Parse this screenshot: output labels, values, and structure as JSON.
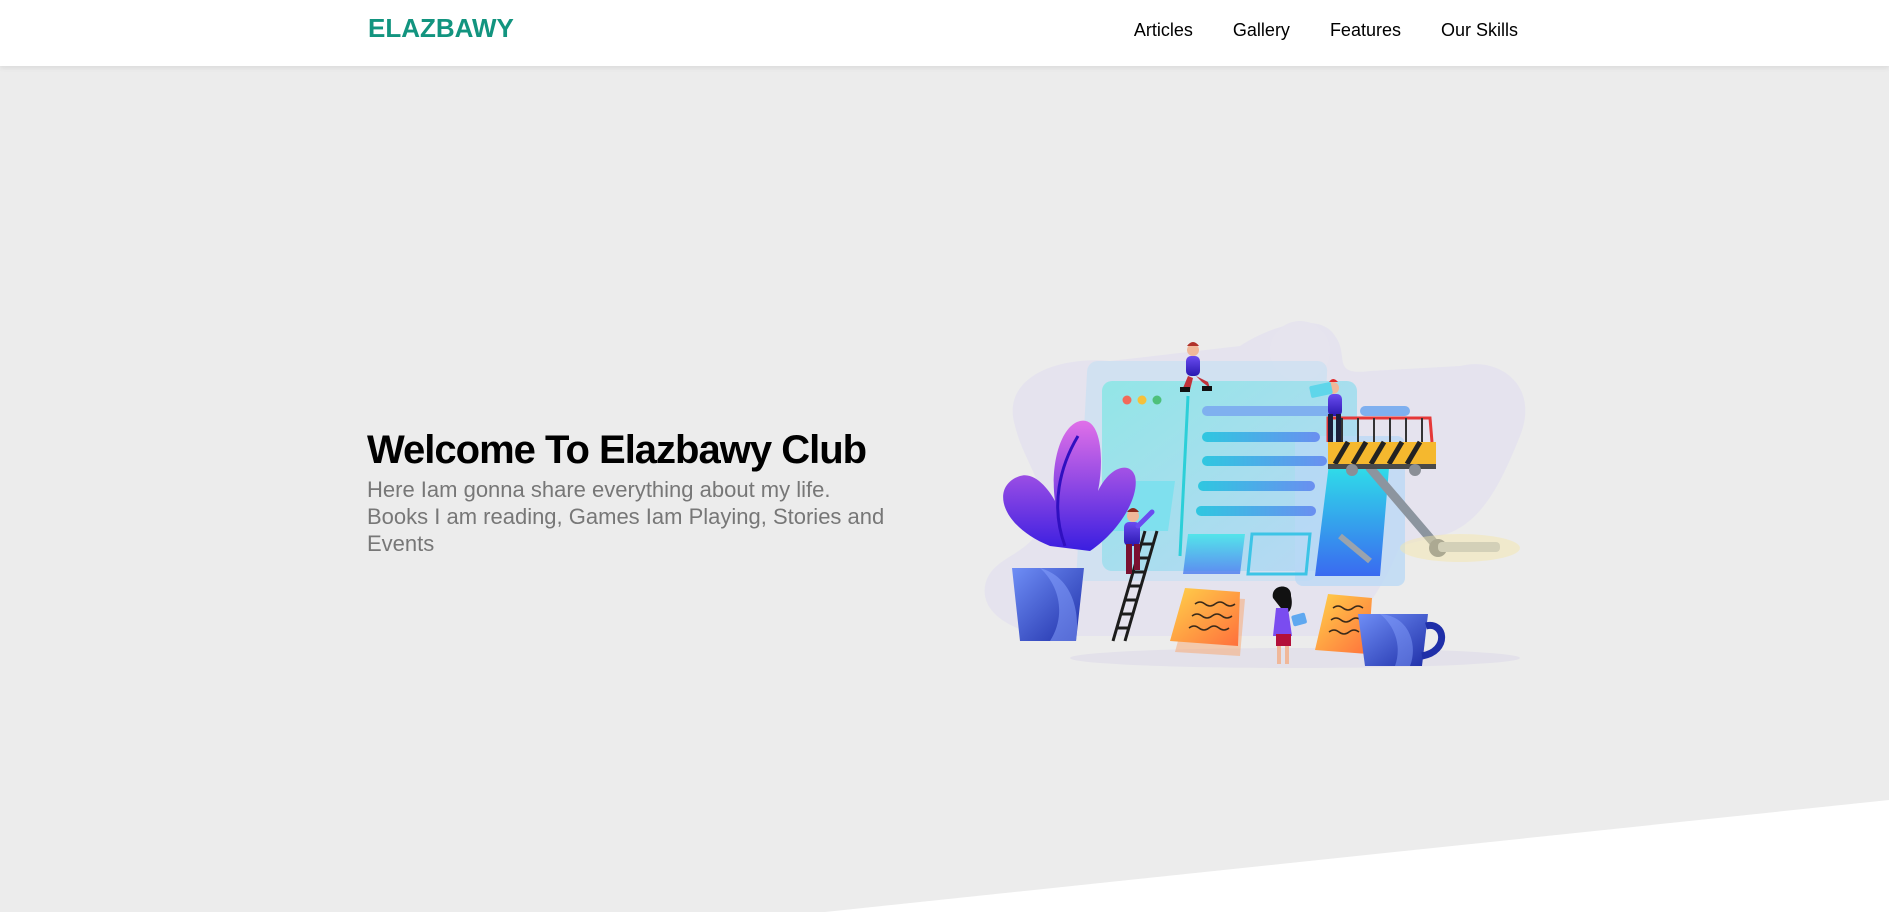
{
  "header": {
    "logo": "ELAZBAWY",
    "nav": [
      {
        "label": "Articles"
      },
      {
        "label": "Gallery"
      },
      {
        "label": "Features"
      },
      {
        "label": "Our Skills"
      }
    ]
  },
  "landing": {
    "title": "Welcome To Elazbawy Club",
    "description": "Here Iam gonna share everything about my life. Books I am reading, Games Iam Playing, Stories and Events"
  },
  "colors": {
    "brand": "#12947f",
    "landing_bg": "#ececec",
    "text_muted": "#777777"
  }
}
